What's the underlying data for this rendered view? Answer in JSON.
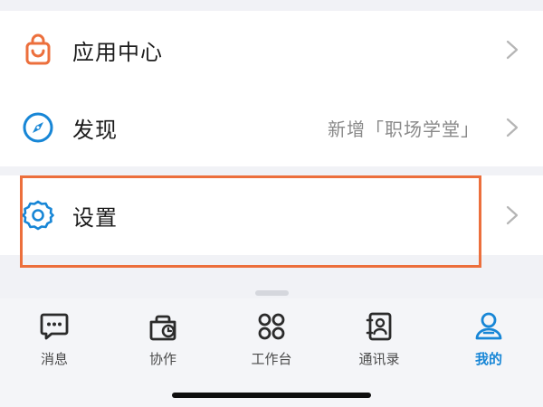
{
  "menu": {
    "apps_label": "应用中心",
    "discover_label": "发现",
    "discover_hint": "新增「职场学堂」",
    "settings_label": "设置"
  },
  "tabbar": {
    "items": [
      {
        "label": "消息",
        "icon": "message-icon"
      },
      {
        "label": "协作",
        "icon": "collaboration-icon"
      },
      {
        "label": "工作台",
        "icon": "workbench-icon"
      },
      {
        "label": "通讯录",
        "icon": "contacts-icon"
      },
      {
        "label": "我的",
        "icon": "profile-icon"
      }
    ],
    "active_index": 4
  },
  "colors": {
    "accent": "#1786d6",
    "apps_icon": "#ec6f3c",
    "highlight_border": "#ec6f3c"
  }
}
